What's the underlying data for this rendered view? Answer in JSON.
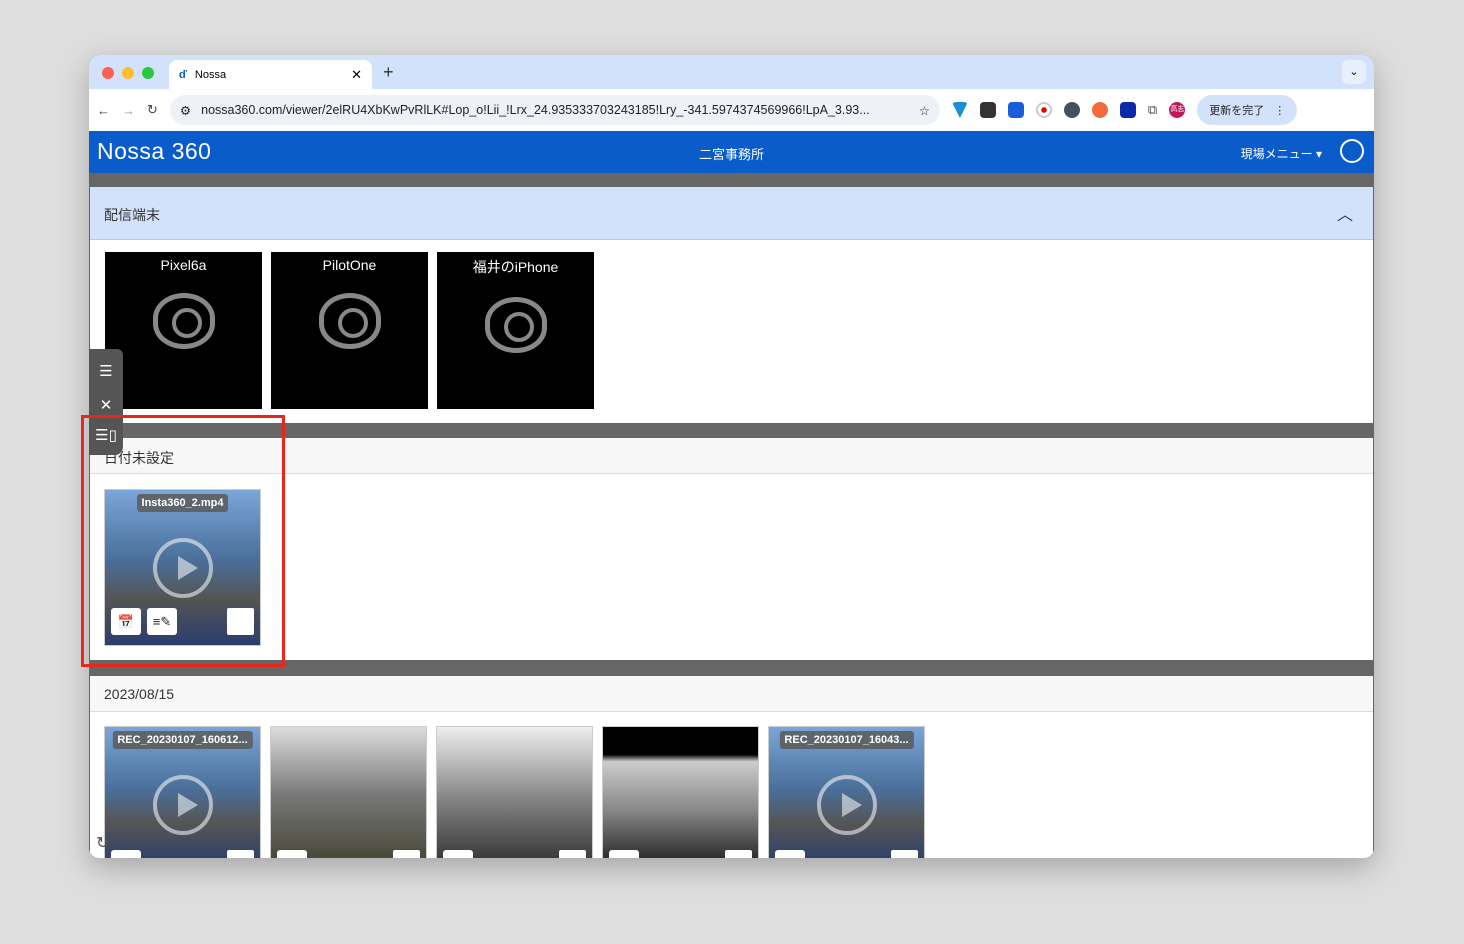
{
  "browser": {
    "tab_title": "Nossa",
    "url": "nossa360.com/viewer/2elRU4XbKwPvRlLK#Lop_o!Lii_!Lrx_24.935333703243185!Lry_-341.5974374569966!LpA_3.93...",
    "profile": "高志",
    "update_label": "更新を完了"
  },
  "app": {
    "logo": "Nossa 360",
    "site_name": "二宮事務所",
    "menu_label": "現場メニュー"
  },
  "devices": {
    "title": "配信端末",
    "items": [
      {
        "name": "Pixel6a"
      },
      {
        "name": "PilotOne"
      },
      {
        "name": "福井のiPhone"
      }
    ]
  },
  "undated": {
    "title": "日付未設定",
    "items": [
      {
        "name": "Insta360_2.mp4"
      }
    ]
  },
  "dated": {
    "title": "2023/08/15",
    "items": [
      {
        "name": "REC_20230107_160612..."
      },
      {
        "name": ""
      },
      {
        "name": ""
      },
      {
        "name": ""
      },
      {
        "name": "REC_20230107_16043..."
      }
    ]
  },
  "colors": {
    "accent": "#0b5ccb",
    "highlight": "#e8261b"
  }
}
